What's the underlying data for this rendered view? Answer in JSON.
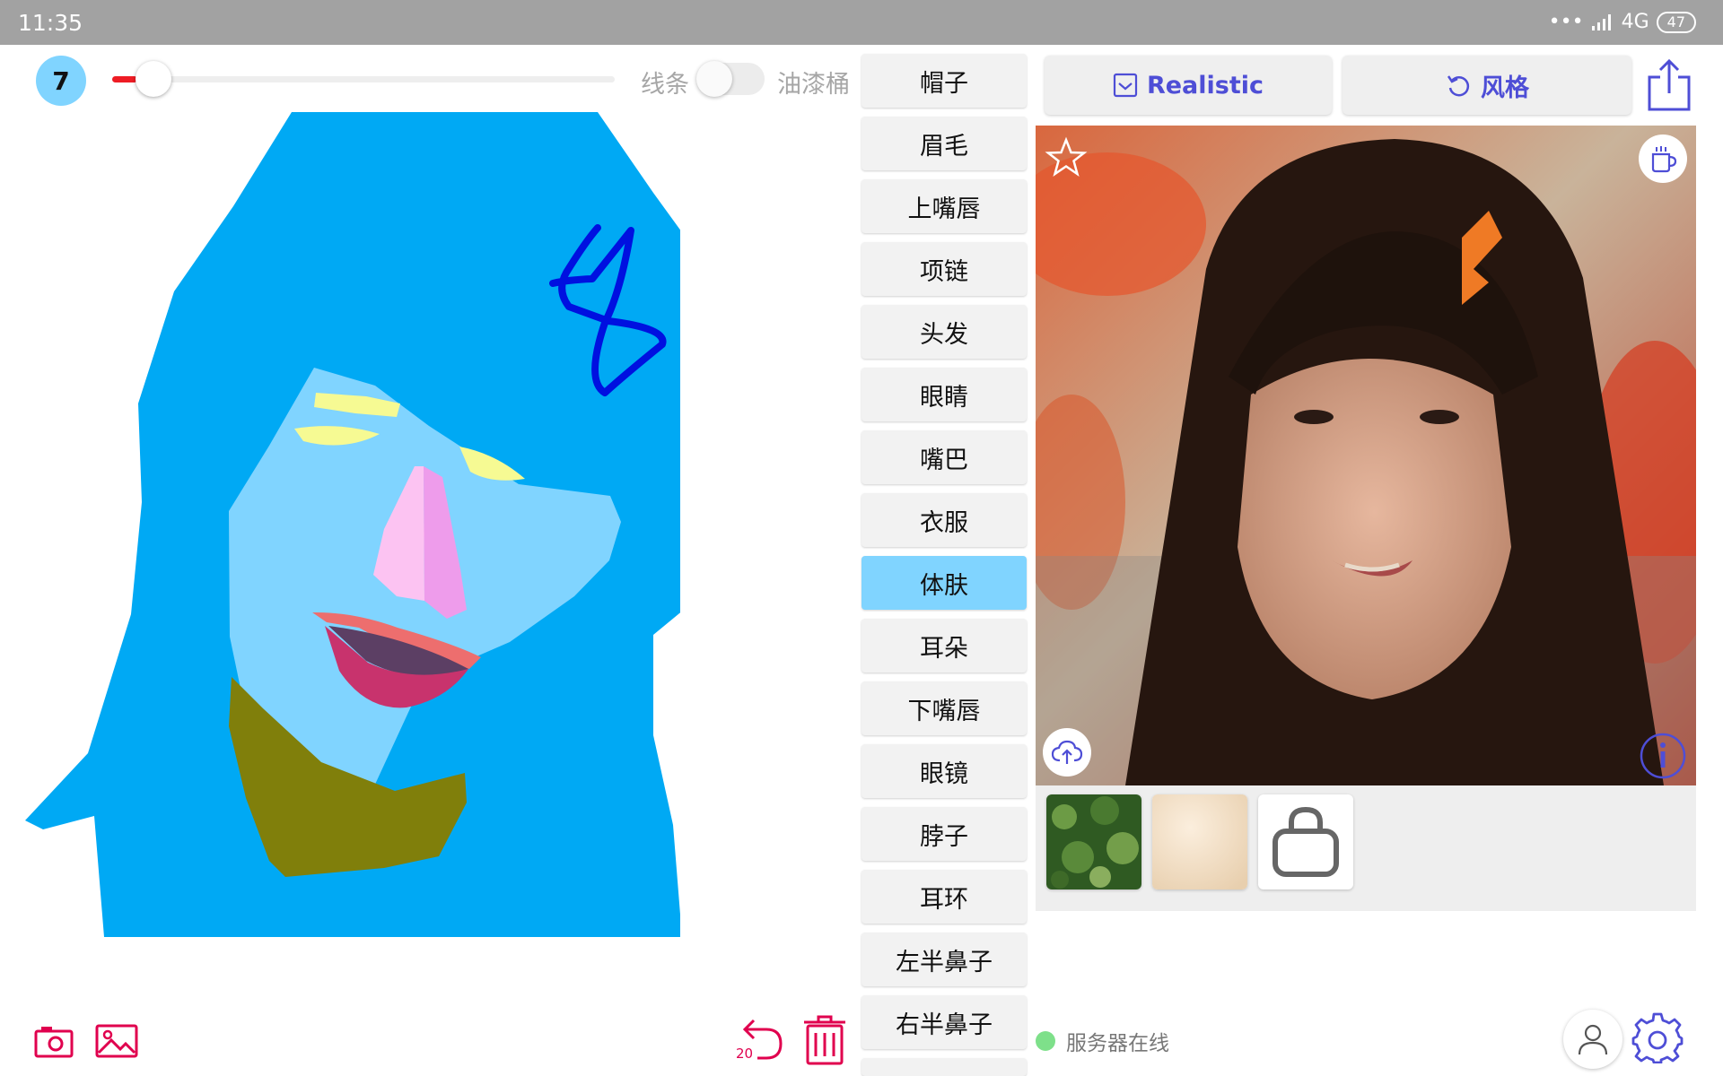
{
  "status_bar": {
    "time": "11:35",
    "network": "4G",
    "battery": "47"
  },
  "toolbar": {
    "brush_size": "7",
    "brush_level": 0.05,
    "mode_line": "线条",
    "mode_fill": "油漆桶"
  },
  "categories": [
    {
      "label": "帽子"
    },
    {
      "label": "眉毛"
    },
    {
      "label": "上嘴唇"
    },
    {
      "label": "项链"
    },
    {
      "label": "头发"
    },
    {
      "label": "眼睛"
    },
    {
      "label": "嘴巴"
    },
    {
      "label": "衣服"
    },
    {
      "label": "体肤"
    },
    {
      "label": "耳朵"
    },
    {
      "label": "下嘴唇"
    },
    {
      "label": "眼镜"
    },
    {
      "label": "脖子"
    },
    {
      "label": "耳环"
    },
    {
      "label": "左半鼻子"
    },
    {
      "label": "右半鼻子"
    }
  ],
  "selected_category": "体肤",
  "right_panel": {
    "realistic_label": "Realistic",
    "style_label": "风格"
  },
  "bottom": {
    "undo_count": "20",
    "server_status": "服务器在线"
  },
  "colors": {
    "accent": "#80d4ff",
    "status_bar": "#a2a2a2",
    "hair": "#00a9f4",
    "skin": "#80d4ff",
    "neck": "#807f0b",
    "link": "#4e4ed6",
    "danger": "#e0004e",
    "server_online": "#7ee08a"
  },
  "icons": [
    "camera-icon",
    "gallery-icon",
    "undo-icon",
    "trash-icon",
    "share-icon",
    "star-icon",
    "cup-icon",
    "cloud-upload-icon",
    "info-icon",
    "user-icon",
    "gear-icon",
    "bag-icon"
  ]
}
